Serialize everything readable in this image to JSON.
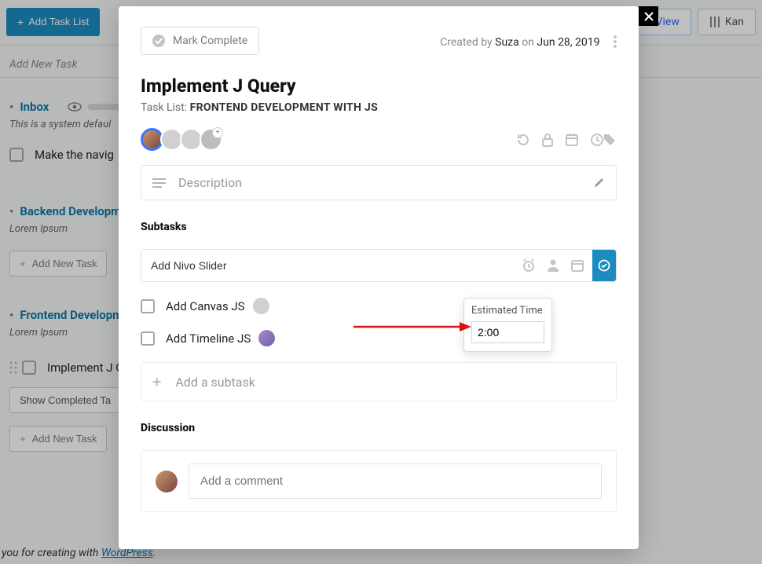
{
  "topbar": {
    "add_task_list": "Add Task List",
    "list_view": "List View",
    "kanban": "Kan"
  },
  "page": {
    "add_new_task": "Add New Task",
    "inbox": {
      "title": "Inbox",
      "sub": "This is a system defaul",
      "task": "Make the navig"
    },
    "backend": {
      "title": "Backend Developm",
      "sub": "Lorem Ipsum",
      "addnew": "Add New Task"
    },
    "frontend": {
      "title": "Frontend Developm",
      "sub": "Lorem Ipsum",
      "task": "Implement J Q",
      "show_completed": "Show Completed Ta",
      "addnew": "Add New Task"
    },
    "footer_prefix": "you for creating with ",
    "footer_link": "WordPress",
    "footer_suffix": "."
  },
  "modal": {
    "mark_complete": "Mark Complete",
    "created_by_prefix": "Created by ",
    "created_by_user": "Suza",
    "created_on": " on ",
    "created_date": "Jun 28, 2019",
    "title": "Implement J Query",
    "tasklist_label": "Task List: ",
    "tasklist_name": "FRONTEND DEVELOPMENT WITH JS",
    "desc_placeholder": "Description",
    "subtasks_heading": "Subtasks",
    "subtask_input_value": "Add Nivo Slider",
    "estimated_label": "Estimated Time",
    "estimated_value": "2:00",
    "subtasks": [
      {
        "label": "Add Canvas JS",
        "avatar": "placeholder"
      },
      {
        "label": "Add Timeline JS",
        "avatar": "user"
      }
    ],
    "add_subtask": "Add a subtask",
    "discussion_heading": "Discussion",
    "comment_placeholder": "Add a comment"
  }
}
